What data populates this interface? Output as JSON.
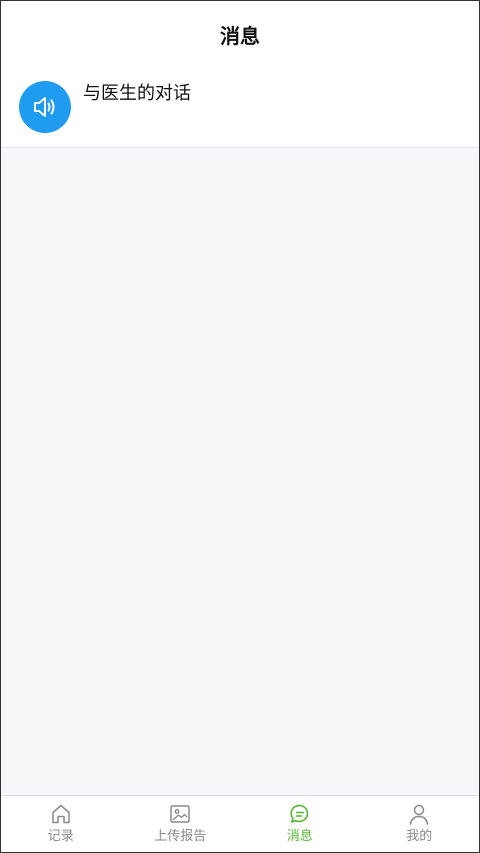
{
  "header": {
    "title": "消息"
  },
  "conversations": [
    {
      "title": "与医生的对话",
      "icon": "speaker-icon",
      "avatar_color": "#1f9bf0"
    }
  ],
  "tabbar": {
    "active_color": "#52b82f",
    "inactive_color": "#8a8a8a",
    "items": [
      {
        "label": "记录",
        "icon": "home-icon",
        "active": false
      },
      {
        "label": "上传报告",
        "icon": "image-icon",
        "active": false
      },
      {
        "label": "消息",
        "icon": "chat-icon",
        "active": true
      },
      {
        "label": "我的",
        "icon": "user-icon",
        "active": false
      }
    ]
  }
}
